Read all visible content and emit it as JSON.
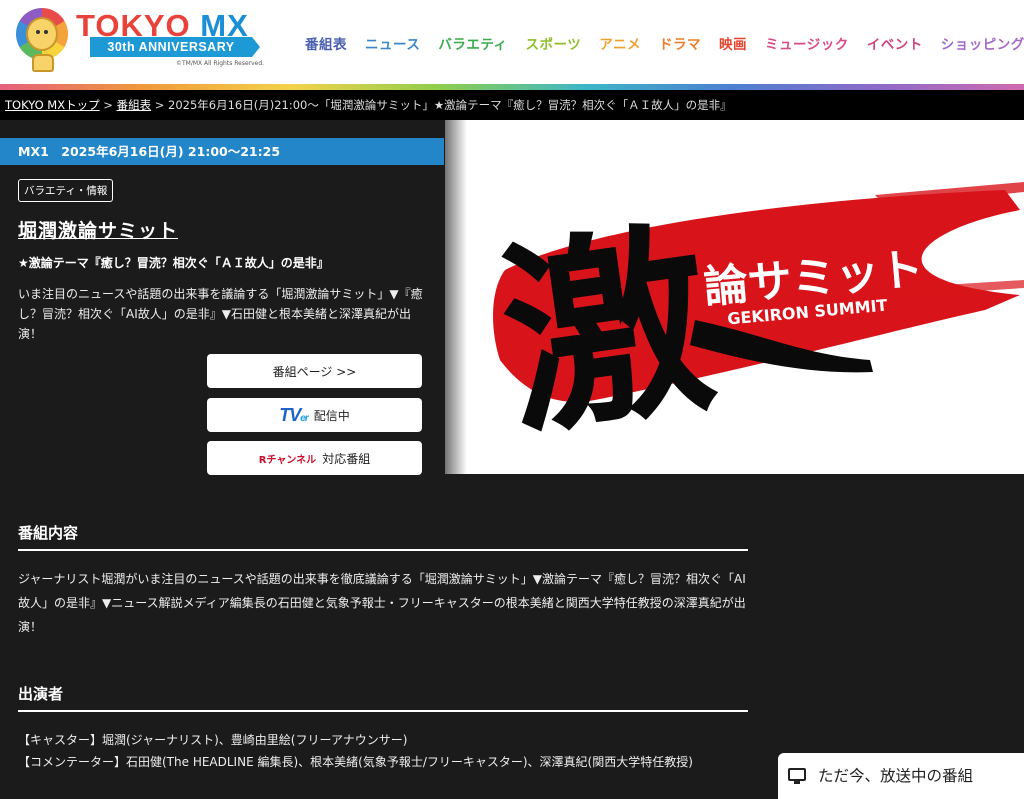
{
  "brand": {
    "name_tokyo": "TOKYO ",
    "name_mx": "MX",
    "anniversary": "30th ANNIVERSARY",
    "copyright": "©TM/MX All Rights Reserved."
  },
  "nav": [
    {
      "label": "番組表",
      "color": "#4a5fb0"
    },
    {
      "label": "ニュース",
      "color": "#3a86c8"
    },
    {
      "label": "バラエティ",
      "color": "#3bab4f"
    },
    {
      "label": "スポーツ",
      "color": "#8fbf2a"
    },
    {
      "label": "アニメ",
      "color": "#f0a030"
    },
    {
      "label": "ドラマ",
      "color": "#ef7d2e"
    },
    {
      "label": "映画",
      "color": "#e5452f"
    },
    {
      "label": "ミュージック",
      "color": "#d94a88"
    },
    {
      "label": "イベント",
      "color": "#d1437f"
    },
    {
      "label": "ショッピング",
      "color": "#a56ac4"
    }
  ],
  "breadcrumb": {
    "home": "TOKYO MXトップ",
    "sep": " > ",
    "schedule": "番組表",
    "current": "2025年6月16日(月)21:00～「堀潤激論サミット」★激論テーマ『癒し？冒涜？相次ぐ「ＡＩ故人」の是非』"
  },
  "program": {
    "airtime": "MX1　2025年6月16日(月) 21:00～21:25",
    "genre": "バラエティ・情報",
    "title": "堀潤激論サミット",
    "subtitle": "★激論テーマ『癒し？冒涜？相次ぐ「ＡＩ故人」の是非』",
    "summary": "いま注目のニュースや話題の出来事を議論する「堀潤激論サミット」▼『癒し？冒涜？相次ぐ「AI故人」の是非』▼石田健と根本美緒と深澤真紀が出演！"
  },
  "buttons": {
    "program_page": "番組ページ >>",
    "tver_logo": "TV",
    "tver_logo_small": "er",
    "tver_label": "配信中",
    "r_channel_logo": "Rチャンネル",
    "r_channel_label": "対応番組"
  },
  "hero": {
    "kanji": "激",
    "title_jp": "論サミット",
    "title_en": "GEKIRON SUMMIT",
    "colors": {
      "brush_red": "#d8141a",
      "ink": "#0a0a0a"
    }
  },
  "details": {
    "heading": "番組内容",
    "text": "ジャーナリスト堀潤がいま注目のニュースや話題の出来事を徹底議論する「堀潤激論サミット」▼激論テーマ『癒し？冒涜？相次ぐ「AI故人」の是非』▼ニュース解説メディア編集長の石田健と気象予報士・フリーキャスターの根本美緒と関西大学特任教授の深澤真紀が出演！"
  },
  "cast": {
    "heading": "出演者",
    "lines": [
      "【キャスター】堀潤(ジャーナリスト)、豊崎由里絵(フリーアナウンサー)",
      "【コメンテーター】石田健(The HEADLINE 編集長)、根本美緒(気象予報士/フリーキャスター)、深澤真紀(関西大学特任教授)"
    ]
  },
  "on_air_tab": {
    "label": "ただ今、放送中の番組"
  }
}
